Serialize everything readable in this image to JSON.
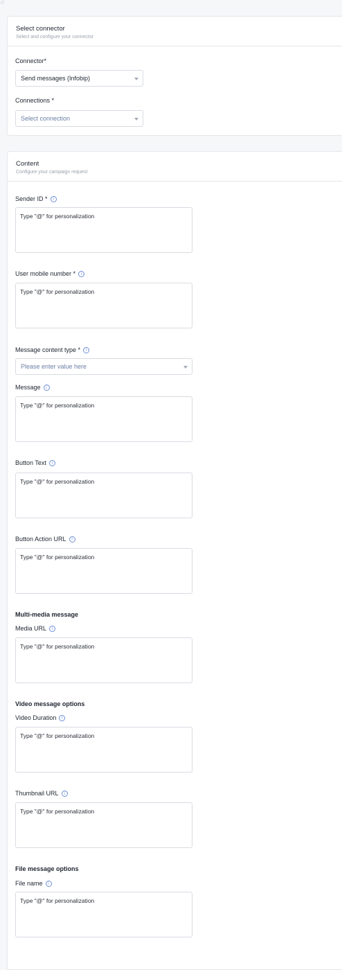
{
  "connector_card": {
    "title": "Select connector",
    "subtitle": "Select and configure your connector",
    "connector_label": "Connector*",
    "connector_value": "Send messages (Infobip)",
    "connections_label": "Connections *",
    "connections_placeholder": "Select connection"
  },
  "content_card": {
    "title": "Content",
    "subtitle": "Configure your campaign request",
    "textarea_placeholder": "Type \"@\" for personalization",
    "fields": {
      "sender_id": "Sender ID *",
      "user_mobile": "User mobile number *",
      "message_content_type": "Message content type *",
      "message_content_type_placeholder": "Please enter value here",
      "message": "Message",
      "button_text": "Button Text",
      "button_action_url": "Button Action URL",
      "media_url": "Media URL",
      "video_duration": "Video Duration",
      "thumbnail_url": "Thumbnail URL",
      "file_name": "File name"
    },
    "sections": {
      "multimedia": "Multi-media message",
      "video": "Video message options",
      "file": "File message options"
    },
    "info_icon_glyph": "i"
  }
}
